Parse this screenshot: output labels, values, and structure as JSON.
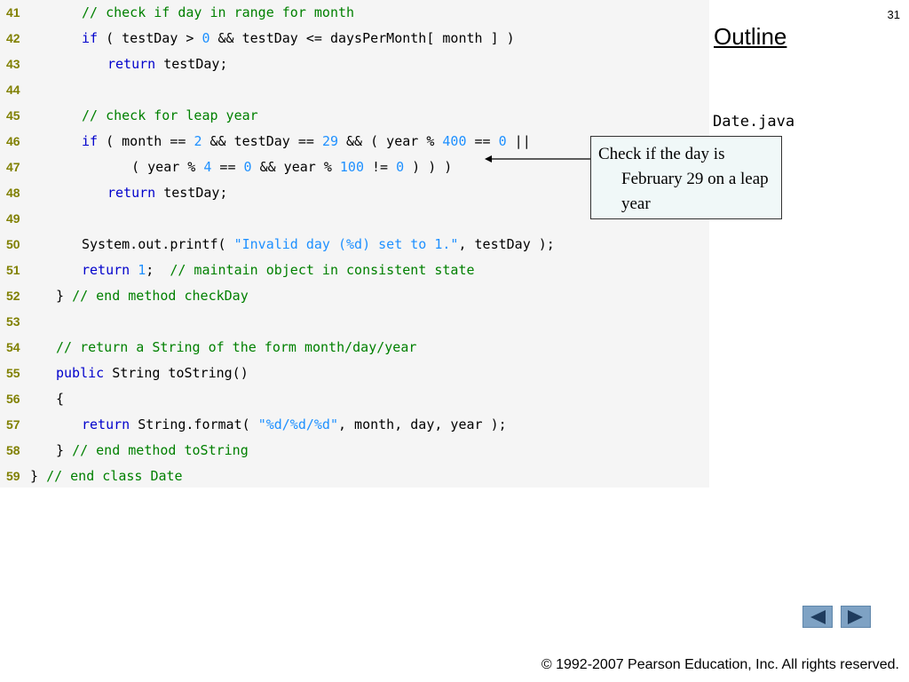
{
  "page_number": "31",
  "outline_label": "Outline",
  "filename": "Date.java",
  "callout": "Check if  the day is February 29 on a leap year",
  "copyright": "© 1992-2007 Pearson Education, Inc.  All rights reserved.",
  "nav": {
    "prev_icon": "triangle-left-icon",
    "next_icon": "triangle-right-icon"
  },
  "colors": {
    "line_number": "#808000",
    "keyword": "#0000cc",
    "comment": "#008000",
    "literal": "#1e90ff",
    "panel_bg": "#f5f5f5",
    "callout_bg": "#f0f8f8",
    "nav_button": "#7ea2c4"
  },
  "code_lines": [
    {
      "no": "41",
      "indent": 2,
      "tokens": [
        [
          "cm",
          "// check if day in range for month"
        ]
      ]
    },
    {
      "no": "42",
      "indent": 2,
      "tokens": [
        [
          "kw",
          "if"
        ],
        [
          "",
          " ( testDay > "
        ],
        [
          "num",
          "0"
        ],
        [
          "",
          " && testDay <= daysPerMonth[ month ] )"
        ]
      ]
    },
    {
      "no": "43",
      "indent": 3,
      "tokens": [
        [
          "kw",
          "return"
        ],
        [
          "",
          " testDay;"
        ]
      ]
    },
    {
      "no": "44",
      "indent": 0,
      "tokens": []
    },
    {
      "no": "45",
      "indent": 2,
      "tokens": [
        [
          "cm",
          "// check for leap year"
        ]
      ]
    },
    {
      "no": "46",
      "indent": 2,
      "tokens": [
        [
          "kw",
          "if"
        ],
        [
          "",
          " ( month == "
        ],
        [
          "num",
          "2"
        ],
        [
          "",
          " && testDay == "
        ],
        [
          "num",
          "29"
        ],
        [
          "",
          " && ( year % "
        ],
        [
          "num",
          "400"
        ],
        [
          "",
          " == "
        ],
        [
          "num",
          "0"
        ],
        [
          "",
          " ||"
        ]
      ]
    },
    {
      "no": "47",
      "indent": 3,
      "tokens": [
        [
          "",
          "   ( year % "
        ],
        [
          "num",
          "4"
        ],
        [
          "",
          " == "
        ],
        [
          "num",
          "0"
        ],
        [
          "",
          " && year % "
        ],
        [
          "num",
          "100"
        ],
        [
          "",
          " != "
        ],
        [
          "num",
          "0"
        ],
        [
          "",
          " ) ) )"
        ]
      ]
    },
    {
      "no": "48",
      "indent": 3,
      "tokens": [
        [
          "kw",
          "return"
        ],
        [
          "",
          " testDay;"
        ]
      ]
    },
    {
      "no": "49",
      "indent": 0,
      "tokens": []
    },
    {
      "no": "50",
      "indent": 2,
      "tokens": [
        [
          "",
          "System.out.printf( "
        ],
        [
          "str",
          "\"Invalid day (%d) set to 1.\""
        ],
        [
          "",
          ", testDay );"
        ]
      ]
    },
    {
      "no": "51",
      "indent": 2,
      "tokens": [
        [
          "kw",
          "return"
        ],
        [
          "",
          " "
        ],
        [
          "num",
          "1"
        ],
        [
          "",
          ";  "
        ],
        [
          "cm",
          "// maintain object in consistent state"
        ]
      ]
    },
    {
      "no": "52",
      "indent": 1,
      "tokens": [
        [
          "",
          "} "
        ],
        [
          "cm",
          "// end method checkDay"
        ]
      ]
    },
    {
      "no": "53",
      "indent": 0,
      "tokens": []
    },
    {
      "no": "54",
      "indent": 1,
      "tokens": [
        [
          "cm",
          "// return a String of the form month/day/year"
        ]
      ]
    },
    {
      "no": "55",
      "indent": 1,
      "tokens": [
        [
          "kw",
          "public"
        ],
        [
          "",
          " String toString()"
        ]
      ]
    },
    {
      "no": "56",
      "indent": 1,
      "tokens": [
        [
          "",
          "{"
        ]
      ]
    },
    {
      "no": "57",
      "indent": 2,
      "tokens": [
        [
          "kw",
          "return"
        ],
        [
          "",
          " String.format( "
        ],
        [
          "str",
          "\"%d/%d/%d\""
        ],
        [
          "",
          ", month, day, year );"
        ]
      ]
    },
    {
      "no": "58",
      "indent": 1,
      "tokens": [
        [
          "",
          "} "
        ],
        [
          "cm",
          "// end method toString"
        ]
      ]
    },
    {
      "no": "59",
      "indent": 0,
      "tokens": [
        [
          "",
          "} "
        ],
        [
          "cm",
          "// end class Date"
        ]
      ]
    }
  ]
}
